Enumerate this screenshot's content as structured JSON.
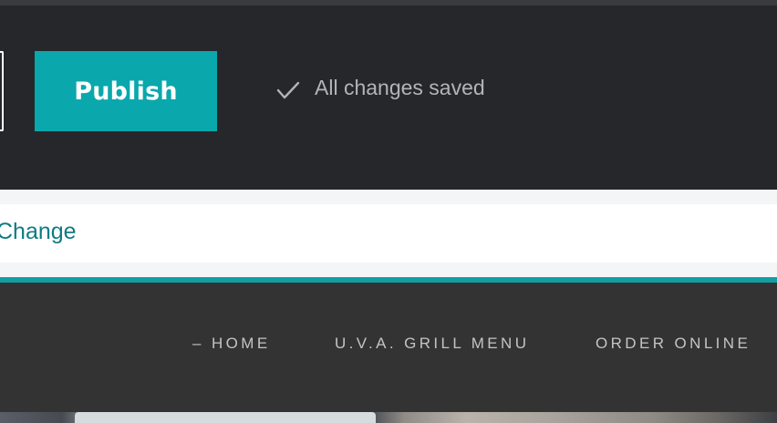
{
  "editor_bar": {
    "publish_label": "Publish",
    "save_status": "All changes saved",
    "save_status_icon": "checkmark-icon"
  },
  "change_bar": {
    "change_label": "Change"
  },
  "site_nav": {
    "items": [
      {
        "label": "– HOME"
      },
      {
        "label": "U.V.A. GRILL MENU"
      },
      {
        "label": "ORDER ONLINE"
      }
    ]
  },
  "colors": {
    "editor_background": "#26272b",
    "publish_button": "#0aa8ac",
    "accent_rule": "#139ea2",
    "link": "#0e7b83",
    "site_nav_background": "#333333"
  }
}
